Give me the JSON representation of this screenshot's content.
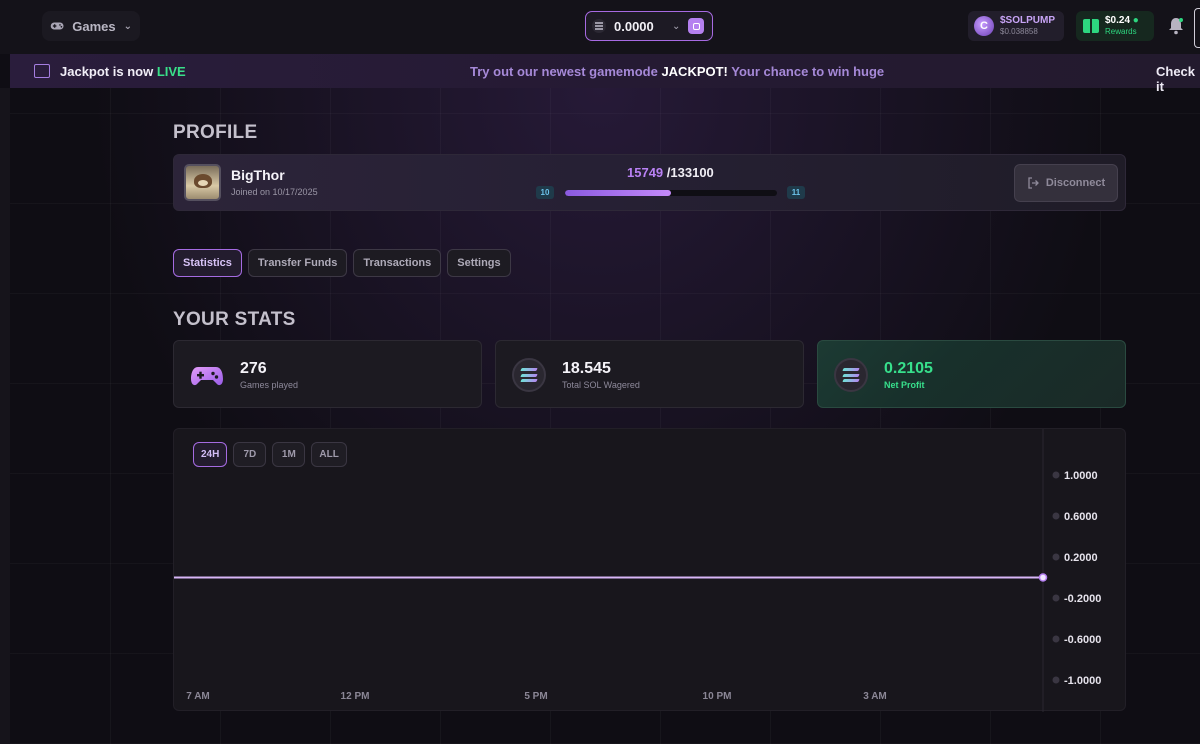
{
  "nav": {
    "games_label": "Games",
    "balance": "0.0000",
    "token": {
      "name": "$SOLPUMP",
      "price": "$0.038858"
    },
    "rewards": {
      "amount": "$0.24",
      "label": "Rewards"
    }
  },
  "banner": {
    "left_prefix": "Jackpot is now ",
    "left_live": "LIVE",
    "mid_prefix": "Try out our newest gamemode ",
    "mid_bold": "JACKPOT!",
    "mid_suffix": " Your chance to win huge",
    "right": "Check it"
  },
  "profile": {
    "heading": "PROFILE",
    "username": "BigThor",
    "joined": "Joined on 10/17/2025",
    "xp_current": "15749",
    "xp_total": "/133100",
    "level_current": "10",
    "level_next": "11",
    "level_progress": 0.5,
    "disconnect_label": "Disconnect"
  },
  "tabs": [
    "Statistics",
    "Transfer Funds",
    "Transactions",
    "Settings"
  ],
  "active_tab": 0,
  "stats": {
    "heading": "YOUR STATS",
    "cards": [
      {
        "value": "276",
        "label": "Games played",
        "icon": "gamepad-icon"
      },
      {
        "value": "18.545",
        "label": "Total SOL Wagered",
        "icon": "sol-icon"
      },
      {
        "value": "0.2105",
        "label": "Net Profit",
        "icon": "sol-icon"
      }
    ]
  },
  "chart_controls": {
    "ranges": [
      "24H",
      "7D",
      "1M",
      "ALL"
    ],
    "active": 0
  },
  "chart_data": {
    "type": "line",
    "x": [
      "7 AM",
      "12 PM",
      "5 PM",
      "10 PM",
      "3 AM"
    ],
    "y_ticks": [
      "1.0000",
      "0.6000",
      "0.2000",
      "-0.2000",
      "-0.6000",
      "-1.0000"
    ],
    "ylim": [
      -1,
      1
    ],
    "series": [
      {
        "values": [
          0,
          0,
          0,
          0,
          0
        ]
      }
    ],
    "colors": {
      "line": "#d7b6f7",
      "point": "#f0e6ff"
    }
  }
}
